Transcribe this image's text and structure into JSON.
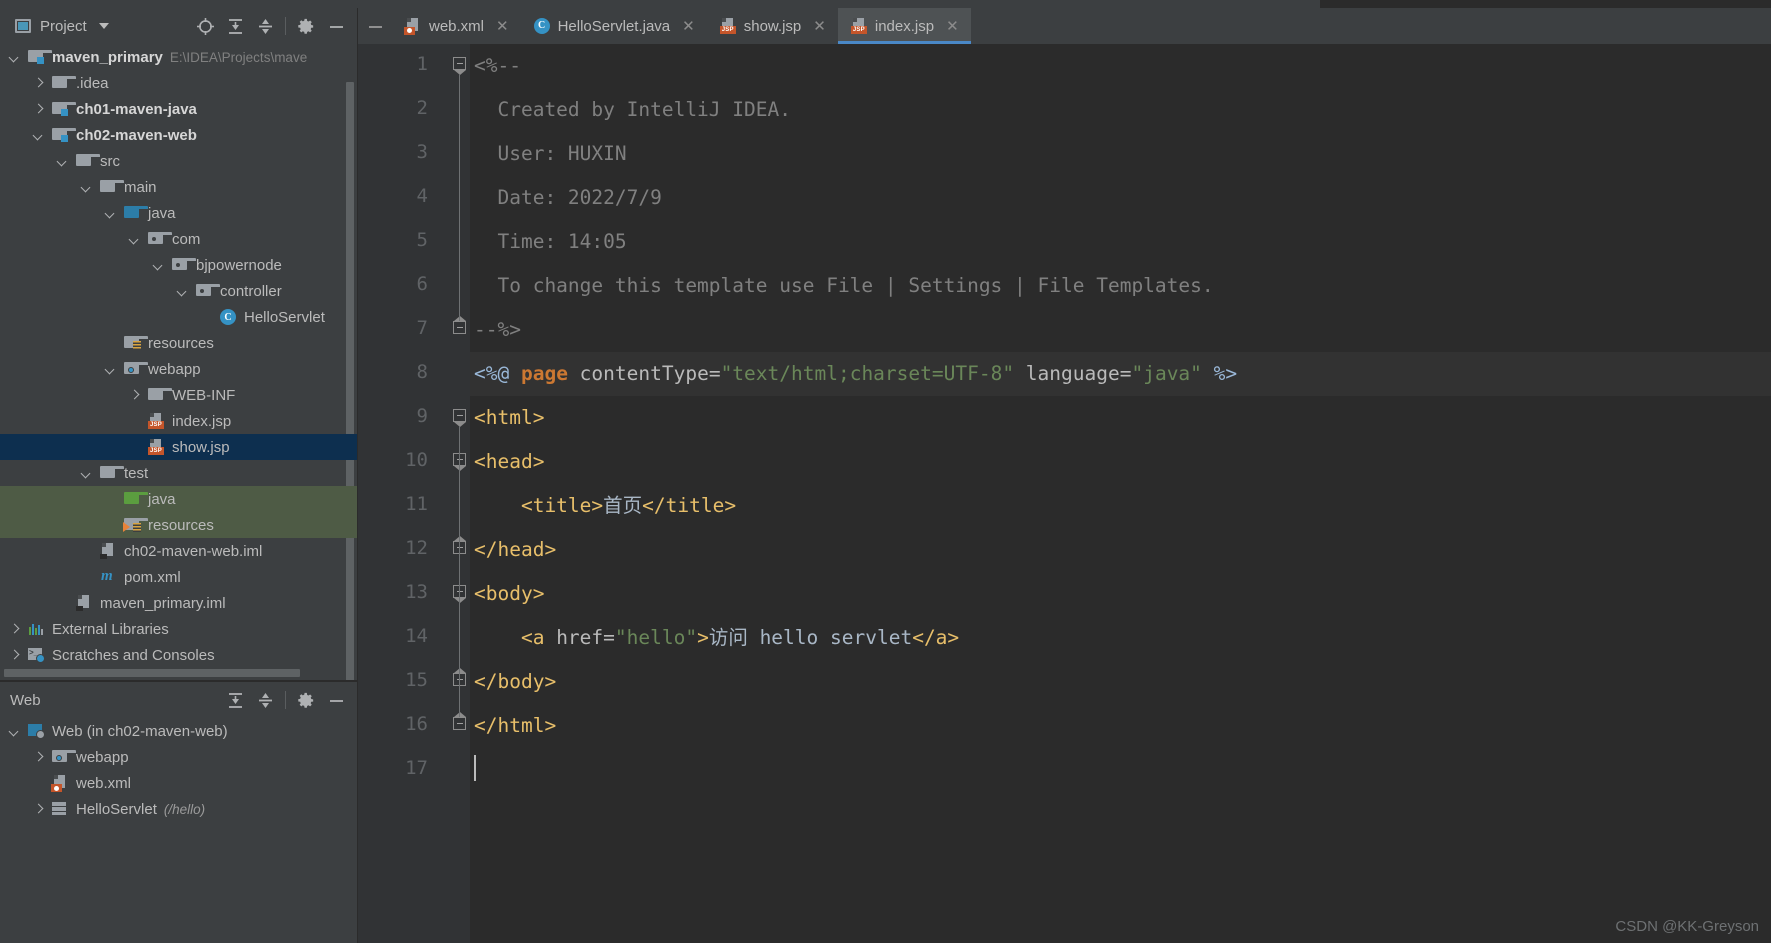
{
  "project_panel": {
    "title": "Project",
    "icons": [
      "project-icon",
      "chevron-down-icon",
      "locate-icon",
      "expand-all-icon",
      "collapse-all-icon",
      "gear-icon",
      "minimize-icon"
    ],
    "tree": [
      {
        "label": "maven_primary",
        "suffix": "E:\\IDEA\\Projects\\mave",
        "icon": "module-folder-icon",
        "arrow": "down",
        "indent": 0,
        "bold": true
      },
      {
        "label": ".idea",
        "suffix": "",
        "icon": "folder-icon",
        "arrow": "right",
        "indent": 1,
        "bold": false
      },
      {
        "label": "ch01-maven-java",
        "suffix": "",
        "icon": "module-folder-icon",
        "arrow": "right",
        "indent": 1,
        "bold": true
      },
      {
        "label": "ch02-maven-web",
        "suffix": "",
        "icon": "module-folder-icon",
        "arrow": "down",
        "indent": 1,
        "bold": true
      },
      {
        "label": "src",
        "suffix": "",
        "icon": "folder-icon",
        "arrow": "down",
        "indent": 2,
        "bold": false
      },
      {
        "label": "main",
        "suffix": "",
        "icon": "folder-icon",
        "arrow": "down",
        "indent": 3,
        "bold": false
      },
      {
        "label": "java",
        "suffix": "",
        "icon": "source-root-folder-icon",
        "arrow": "down",
        "indent": 4,
        "bold": false
      },
      {
        "label": "com",
        "suffix": "",
        "icon": "package-folder-icon",
        "arrow": "down",
        "indent": 5,
        "bold": false
      },
      {
        "label": "bjpowernode",
        "suffix": "",
        "icon": "package-folder-icon",
        "arrow": "down",
        "indent": 6,
        "bold": false
      },
      {
        "label": "controller",
        "suffix": "",
        "icon": "package-folder-icon",
        "arrow": "down",
        "indent": 7,
        "bold": false
      },
      {
        "label": "HelloServlet",
        "suffix": "",
        "icon": "java-class-icon",
        "arrow": "none",
        "indent": 8,
        "bold": false
      },
      {
        "label": "resources",
        "suffix": "",
        "icon": "resources-folder-icon",
        "arrow": "none",
        "indent": 4,
        "bold": false
      },
      {
        "label": "webapp",
        "suffix": "",
        "icon": "webapp-folder-icon",
        "arrow": "down",
        "indent": 4,
        "bold": false
      },
      {
        "label": "WEB-INF",
        "suffix": "",
        "icon": "folder-icon",
        "arrow": "right",
        "indent": 5,
        "bold": false
      },
      {
        "label": "index.jsp",
        "suffix": "",
        "icon": "jsp-file-icon",
        "arrow": "none",
        "indent": 5,
        "bold": false
      },
      {
        "label": "show.jsp",
        "suffix": "",
        "icon": "jsp-file-icon",
        "arrow": "none",
        "indent": 5,
        "bold": false,
        "selected": true
      },
      {
        "label": "test",
        "suffix": "",
        "icon": "folder-icon",
        "arrow": "down",
        "indent": 3,
        "bold": false
      },
      {
        "label": "java",
        "suffix": "",
        "icon": "test-source-folder-icon",
        "arrow": "none",
        "indent": 4,
        "bold": false,
        "highlight": "green"
      },
      {
        "label": "resources",
        "suffix": "",
        "icon": "test-resources-folder-icon",
        "arrow": "none",
        "indent": 4,
        "bold": false,
        "highlight": "green"
      },
      {
        "label": "ch02-maven-web.iml",
        "suffix": "",
        "icon": "iml-file-icon",
        "arrow": "none",
        "indent": 3,
        "bold": false
      },
      {
        "label": "pom.xml",
        "suffix": "",
        "icon": "maven-file-icon",
        "arrow": "none",
        "indent": 3,
        "bold": false
      },
      {
        "label": "maven_primary.iml",
        "suffix": "",
        "icon": "iml-file-icon",
        "arrow": "none",
        "indent": 2,
        "bold": false
      },
      {
        "label": "External Libraries",
        "suffix": "",
        "icon": "external-libraries-icon",
        "arrow": "right",
        "indent": 0,
        "bold": false
      },
      {
        "label": "Scratches and Consoles",
        "suffix": "",
        "icon": "scratches-icon",
        "arrow": "right",
        "indent": 0,
        "bold": false
      }
    ]
  },
  "web_panel": {
    "title": "Web",
    "icons": [
      "expand-all-icon",
      "collapse-all-icon",
      "gear-icon",
      "minimize-icon"
    ],
    "tree": [
      {
        "label": "Web (in ch02-maven-web)",
        "suffix": "",
        "icon": "web-module-icon",
        "arrow": "down",
        "indent": 0
      },
      {
        "label": "webapp",
        "suffix": "",
        "icon": "webapp-folder-icon",
        "arrow": "right",
        "indent": 1
      },
      {
        "label": "web.xml",
        "suffix": "",
        "icon": "xml-file-icon",
        "arrow": "none",
        "indent": 1
      },
      {
        "label": "HelloServlet",
        "suffix": "(/hello)",
        "icon": "servlet-icon",
        "arrow": "right",
        "indent": 1
      }
    ]
  },
  "editor": {
    "tabs": [
      {
        "label": "web.xml",
        "icon": "xml-file-icon",
        "active": false,
        "closable": true
      },
      {
        "label": "HelloServlet.java",
        "icon": "java-class-icon",
        "active": false,
        "closable": true
      },
      {
        "label": "show.jsp",
        "icon": "jsp-file-icon",
        "active": false,
        "closable": true
      },
      {
        "label": "index.jsp",
        "icon": "jsp-file-icon",
        "active": true,
        "closable": true
      }
    ],
    "line_numbers": [
      "1",
      "2",
      "3",
      "4",
      "5",
      "6",
      "7",
      "8",
      "9",
      "10",
      "11",
      "12",
      "13",
      "14",
      "15",
      "16",
      "17"
    ],
    "lines": [
      {
        "n": 1,
        "tokens": [
          {
            "t": "comment",
            "v": "<%--"
          }
        ]
      },
      {
        "n": 2,
        "tokens": [
          {
            "t": "comment",
            "v": "  Created by IntelliJ IDEA."
          }
        ]
      },
      {
        "n": 3,
        "tokens": [
          {
            "t": "comment",
            "v": "  User: HUXIN"
          }
        ]
      },
      {
        "n": 4,
        "tokens": [
          {
            "t": "comment",
            "v": "  Date: 2022/7/9"
          }
        ]
      },
      {
        "n": 5,
        "tokens": [
          {
            "t": "comment",
            "v": "  Time: 14:05"
          }
        ]
      },
      {
        "n": 6,
        "tokens": [
          {
            "t": "comment",
            "v": "  To change this template use File | Settings | File Templates."
          }
        ]
      },
      {
        "n": 7,
        "tokens": [
          {
            "t": "comment",
            "v": "--%>"
          }
        ]
      },
      {
        "n": 8,
        "highlight": true,
        "tokens": [
          {
            "t": "dir",
            "v": "<%@ "
          },
          {
            "t": "kw",
            "v": "page"
          },
          {
            "t": "attr",
            "v": " contentType="
          },
          {
            "t": "str",
            "v": "\"text/html;charset=UTF-8\""
          },
          {
            "t": "attr",
            "v": " language="
          },
          {
            "t": "str",
            "v": "\"java\""
          },
          {
            "t": "dir",
            "v": " %>"
          }
        ]
      },
      {
        "n": 9,
        "tokens": [
          {
            "t": "tag",
            "v": "<html>"
          }
        ]
      },
      {
        "n": 10,
        "tokens": [
          {
            "t": "tag",
            "v": "<head>"
          }
        ]
      },
      {
        "n": 11,
        "tokens": [
          {
            "t": "tag",
            "v": "    <title>"
          },
          {
            "t": "txt",
            "v": "首页"
          },
          {
            "t": "tag",
            "v": "</title>"
          }
        ]
      },
      {
        "n": 12,
        "tokens": [
          {
            "t": "tag",
            "v": "</head>"
          }
        ]
      },
      {
        "n": 13,
        "tokens": [
          {
            "t": "tag",
            "v": "<body>"
          }
        ]
      },
      {
        "n": 14,
        "tokens": [
          {
            "t": "tag",
            "v": "    <a "
          },
          {
            "t": "attr",
            "v": "href="
          },
          {
            "t": "str",
            "v": "\"hello\""
          },
          {
            "t": "tag",
            "v": ">"
          },
          {
            "t": "txt",
            "v": "访问 hello servlet"
          },
          {
            "t": "tag",
            "v": "</a>"
          }
        ]
      },
      {
        "n": 15,
        "tokens": [
          {
            "t": "tag",
            "v": "</body>"
          }
        ]
      },
      {
        "n": 16,
        "tokens": [
          {
            "t": "tag",
            "v": "</html>"
          }
        ]
      },
      {
        "n": 17,
        "tokens": [
          {
            "t": "caret",
            "v": ""
          }
        ]
      }
    ]
  },
  "watermark": "CSDN @KK-Greyson",
  "colors": {
    "panel_bg": "#3C3F41",
    "editor_bg": "#2B2B2B",
    "gutter_bg": "#313335",
    "selection_blue": "#0D2F4F",
    "highlight_green": "#4E5B45",
    "accent_blue": "#4A88C7",
    "tag_orange": "#E8BF6A",
    "string_green": "#6A8759",
    "keyword_orange": "#CC7832",
    "comment_gray": "#808080",
    "text_gray": "#A9B7C6"
  }
}
